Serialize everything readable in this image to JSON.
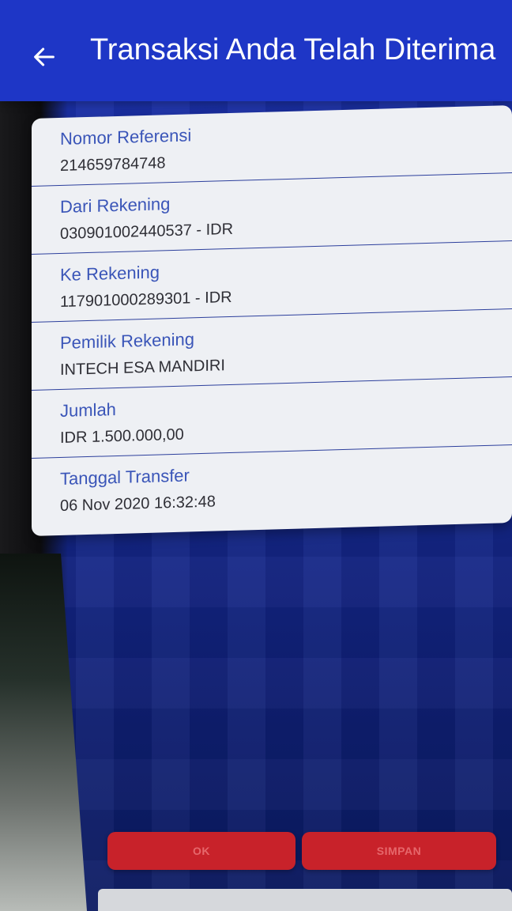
{
  "header": {
    "title": "Transaksi Anda Telah Diterima",
    "back_icon": "arrow-left-icon"
  },
  "details": [
    {
      "label": "Nomor Referensi",
      "value": "214659784748"
    },
    {
      "label": "Dari Rekening",
      "value": "030901002440537 - IDR"
    },
    {
      "label": "Ke Rekening",
      "value": "117901000289301 - IDR"
    },
    {
      "label": "Pemilik Rekening",
      "value": "INTECH ESA MANDIRI"
    },
    {
      "label": "Jumlah",
      "value": "IDR 1.500.000,00"
    },
    {
      "label": "Tanggal Transfer",
      "value": "06 Nov 2020 16:32:48"
    }
  ],
  "footer": {
    "ok_label": "OK",
    "save_label": "SIMPAN"
  },
  "colors": {
    "header": "#1e36c6",
    "label": "#3a55b8",
    "button": "#c8222a"
  }
}
